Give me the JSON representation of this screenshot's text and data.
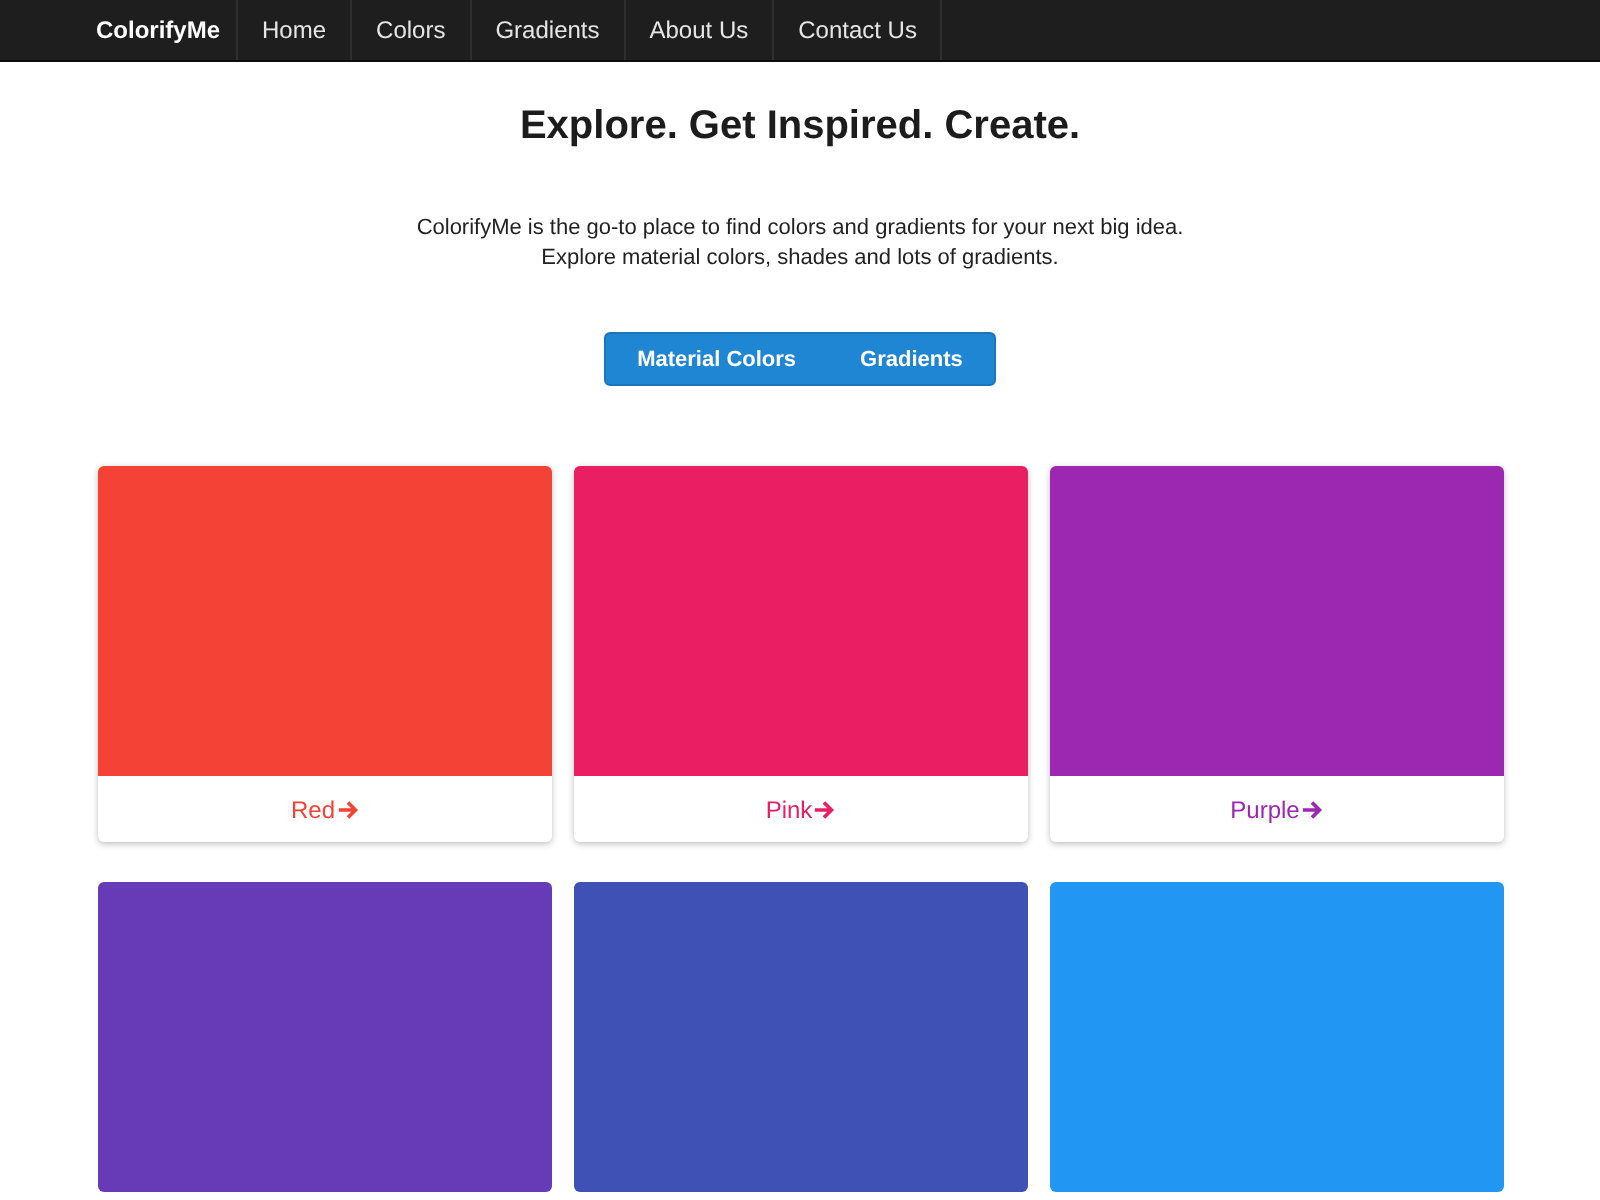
{
  "navbar": {
    "brand": "ColorifyMe",
    "links": [
      "Home",
      "Colors",
      "Gradients",
      "About Us",
      "Contact Us"
    ]
  },
  "hero": {
    "title": "Explore. Get Inspired. Create.",
    "description": [
      "ColorifyMe is the go-to place to find colors and gradients for your next big idea.",
      "Explore material colors, shades and lots of gradients."
    ]
  },
  "toggle_buttons": [
    "Material Colors",
    "Gradients"
  ],
  "cards": [
    {
      "name": "Red",
      "color": "#f44336"
    },
    {
      "name": "Pink",
      "color": "#e91e63"
    },
    {
      "name": "Purple",
      "color": "#9c27b0"
    },
    {
      "color": "#673ab7"
    },
    {
      "color": "#3f51b5"
    },
    {
      "color": "#2196f3"
    }
  ]
}
